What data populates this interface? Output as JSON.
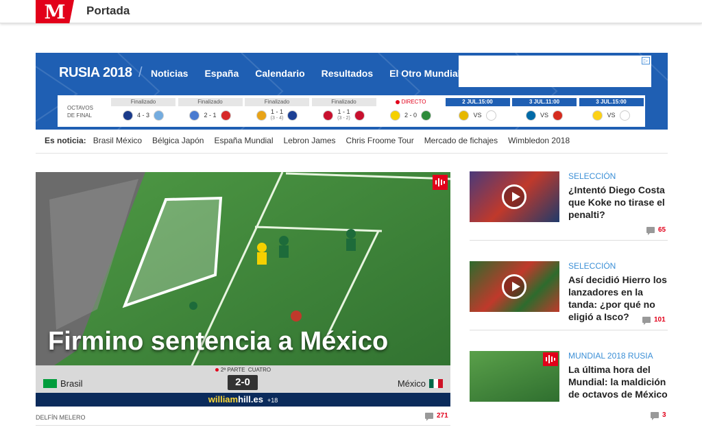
{
  "header": {
    "logo_letter": "M",
    "section": "Portada"
  },
  "worldcup": {
    "brand": "RUSIA 2018",
    "separator": "/",
    "nav": [
      "Noticias",
      "España",
      "Calendario",
      "Resultados",
      "El Otro Mundial"
    ],
    "round_label_1": "OCTAVOS",
    "round_label_2": "DE FINAL",
    "matches": [
      {
        "status": "Finalizado",
        "score": "4 - 3",
        "pens": "",
        "home_flag": "#1a3a8a",
        "away_flag": "#74acdf",
        "kind": "done"
      },
      {
        "status": "Finalizado",
        "score": "2 - 1",
        "pens": "",
        "home_flag": "#4a7bd0",
        "away_flag": "#d62828",
        "kind": "done"
      },
      {
        "status": "Finalizado",
        "score": "1 - 1",
        "pens": "(3 - 4)",
        "home_flag": "#e8a317",
        "away_flag": "#1c3f94",
        "kind": "done"
      },
      {
        "status": "Finalizado",
        "score": "1 - 1",
        "pens": "(3 - 2)",
        "home_flag": "#c8102e",
        "away_flag": "#c8102e",
        "kind": "done"
      },
      {
        "status": "DIRECTO",
        "score": "2 - 0",
        "pens": "",
        "home_flag": "#f5d000",
        "away_flag": "#2e8b3a",
        "kind": "live"
      },
      {
        "status": "2 JUL.15:00",
        "score": "VS",
        "pens": "",
        "home_flag": "#e6b800",
        "away_flag": "#ffffff",
        "kind": "date"
      },
      {
        "status": "3 JUL.11:00",
        "score": "VS",
        "pens": "",
        "home_flag": "#006aa7",
        "away_flag": "#d52b1e",
        "kind": "date"
      },
      {
        "status": "3 JUL.15:00",
        "score": "VS",
        "pens": "",
        "home_flag": "#fcd116",
        "away_flag": "#ffffff",
        "kind": "date"
      }
    ]
  },
  "noticia": {
    "label": "Es noticia:",
    "links": [
      "Brasil México",
      "Bélgica Japón",
      "España Mundial",
      "Lebron James",
      "Chris Froome Tour",
      "Mercado de fichajes",
      "Wimbledon 2018"
    ]
  },
  "feature": {
    "title": "Firmino sentencia a México",
    "period": "2ª PARTE",
    "channel": "CUATRO",
    "score": "2-0",
    "home": "Brasil",
    "away": "México",
    "sponsor_a": "william",
    "sponsor_b": "hill.es",
    "age": "+18",
    "author": "DELFÍN MELERO",
    "comments": "271"
  },
  "side": [
    {
      "section": "SELECCIÓN",
      "headline": "¿Intentó Diego Costa que Koke no tirase el penalti?",
      "comments": "65"
    },
    {
      "section": "SELECCIÓN",
      "headline": "Así decidió Hierro los lanzadores en la tanda: ¿por qué no eligió a Isco?",
      "comments": "101"
    },
    {
      "section": "MUNDIAL 2018 RUSIA",
      "headline": "La última hora del Mundial: la maldición de octavos de México",
      "comments": "3"
    }
  ],
  "colors": {
    "brand_red": "#e2001a",
    "wc_blue": "#1f5fb3",
    "link_blue": "#3b8fd6"
  }
}
